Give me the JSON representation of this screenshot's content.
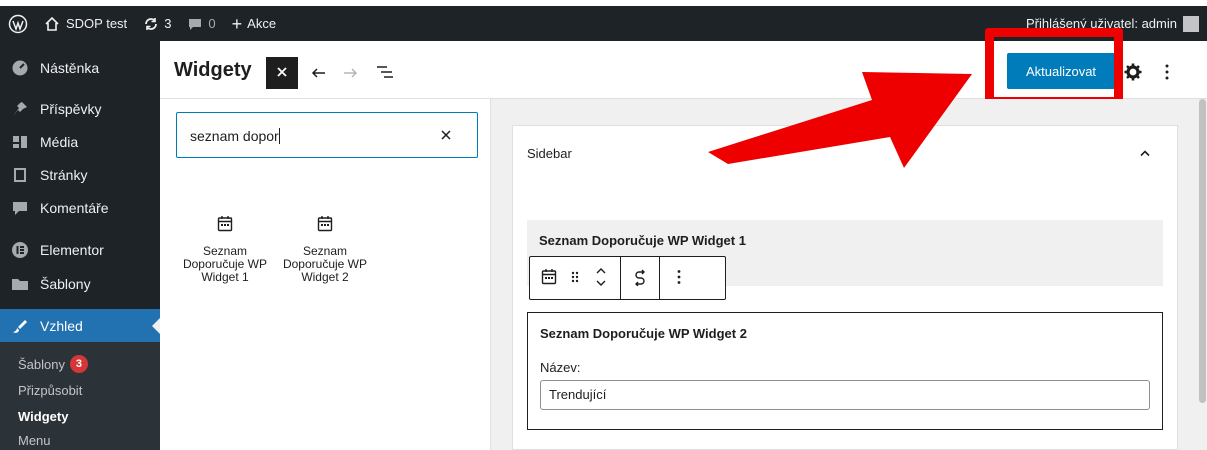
{
  "adminbar": {
    "site_name": "SDOP test",
    "updates_count": "3",
    "comments_count": "0",
    "new_label": "Akce",
    "user_greeting": "Přihlášený uživatel: admin"
  },
  "sidebar": {
    "items": [
      {
        "label": "Nástěnka",
        "icon": "dashboard-icon"
      },
      {
        "label": "Příspěvky",
        "icon": "pin-icon"
      },
      {
        "label": "Média",
        "icon": "media-icon"
      },
      {
        "label": "Stránky",
        "icon": "page-icon"
      },
      {
        "label": "Komentáře",
        "icon": "comment-icon"
      },
      {
        "label": "Elementor",
        "icon": "elementor-icon"
      },
      {
        "label": "Šablony",
        "icon": "folder-icon"
      },
      {
        "label": "Vzhled",
        "icon": "brush-icon",
        "active": true
      }
    ],
    "submenu": [
      {
        "label": "Šablony",
        "badge": "3"
      },
      {
        "label": "Přizpůsobit"
      },
      {
        "label": "Widgety",
        "current": true
      },
      {
        "label": "Menu"
      }
    ]
  },
  "header": {
    "title": "Widgety",
    "update_label": "Aktualizovat"
  },
  "inserter": {
    "search_value": "seznam dopor",
    "results": [
      {
        "label": "Seznam Doporučuje WP Widget 1",
        "icon": "calendar-icon"
      },
      {
        "label": "Seznam Doporučuje WP Widget 2",
        "icon": "calendar-icon"
      }
    ]
  },
  "canvas": {
    "sidebar_title": "Sidebar",
    "widget1_title": "Seznam Doporučuje WP Widget 1",
    "widget2_title": "Seznam Doporučuje WP Widget 2",
    "field_label": "Název:",
    "field_value": "Trendující"
  },
  "colors": {
    "admin_dark": "#1d2327",
    "accent": "#2271b1",
    "button": "#007cba",
    "annotation": "#ee0000",
    "badge": "#d63638"
  }
}
